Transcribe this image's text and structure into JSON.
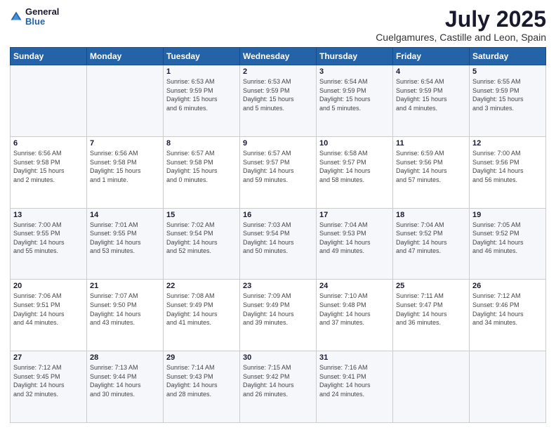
{
  "logo": {
    "text_general": "General",
    "text_blue": "Blue"
  },
  "header": {
    "month": "July 2025",
    "location": "Cuelgamures, Castille and Leon, Spain"
  },
  "weekdays": [
    "Sunday",
    "Monday",
    "Tuesday",
    "Wednesday",
    "Thursday",
    "Friday",
    "Saturday"
  ],
  "weeks": [
    [
      {
        "day": "",
        "info": ""
      },
      {
        "day": "",
        "info": ""
      },
      {
        "day": "1",
        "info": "Sunrise: 6:53 AM\nSunset: 9:59 PM\nDaylight: 15 hours\nand 6 minutes."
      },
      {
        "day": "2",
        "info": "Sunrise: 6:53 AM\nSunset: 9:59 PM\nDaylight: 15 hours\nand 5 minutes."
      },
      {
        "day": "3",
        "info": "Sunrise: 6:54 AM\nSunset: 9:59 PM\nDaylight: 15 hours\nand 5 minutes."
      },
      {
        "day": "4",
        "info": "Sunrise: 6:54 AM\nSunset: 9:59 PM\nDaylight: 15 hours\nand 4 minutes."
      },
      {
        "day": "5",
        "info": "Sunrise: 6:55 AM\nSunset: 9:59 PM\nDaylight: 15 hours\nand 3 minutes."
      }
    ],
    [
      {
        "day": "6",
        "info": "Sunrise: 6:56 AM\nSunset: 9:58 PM\nDaylight: 15 hours\nand 2 minutes."
      },
      {
        "day": "7",
        "info": "Sunrise: 6:56 AM\nSunset: 9:58 PM\nDaylight: 15 hours\nand 1 minute."
      },
      {
        "day": "8",
        "info": "Sunrise: 6:57 AM\nSunset: 9:58 PM\nDaylight: 15 hours\nand 0 minutes."
      },
      {
        "day": "9",
        "info": "Sunrise: 6:57 AM\nSunset: 9:57 PM\nDaylight: 14 hours\nand 59 minutes."
      },
      {
        "day": "10",
        "info": "Sunrise: 6:58 AM\nSunset: 9:57 PM\nDaylight: 14 hours\nand 58 minutes."
      },
      {
        "day": "11",
        "info": "Sunrise: 6:59 AM\nSunset: 9:56 PM\nDaylight: 14 hours\nand 57 minutes."
      },
      {
        "day": "12",
        "info": "Sunrise: 7:00 AM\nSunset: 9:56 PM\nDaylight: 14 hours\nand 56 minutes."
      }
    ],
    [
      {
        "day": "13",
        "info": "Sunrise: 7:00 AM\nSunset: 9:55 PM\nDaylight: 14 hours\nand 55 minutes."
      },
      {
        "day": "14",
        "info": "Sunrise: 7:01 AM\nSunset: 9:55 PM\nDaylight: 14 hours\nand 53 minutes."
      },
      {
        "day": "15",
        "info": "Sunrise: 7:02 AM\nSunset: 9:54 PM\nDaylight: 14 hours\nand 52 minutes."
      },
      {
        "day": "16",
        "info": "Sunrise: 7:03 AM\nSunset: 9:54 PM\nDaylight: 14 hours\nand 50 minutes."
      },
      {
        "day": "17",
        "info": "Sunrise: 7:04 AM\nSunset: 9:53 PM\nDaylight: 14 hours\nand 49 minutes."
      },
      {
        "day": "18",
        "info": "Sunrise: 7:04 AM\nSunset: 9:52 PM\nDaylight: 14 hours\nand 47 minutes."
      },
      {
        "day": "19",
        "info": "Sunrise: 7:05 AM\nSunset: 9:52 PM\nDaylight: 14 hours\nand 46 minutes."
      }
    ],
    [
      {
        "day": "20",
        "info": "Sunrise: 7:06 AM\nSunset: 9:51 PM\nDaylight: 14 hours\nand 44 minutes."
      },
      {
        "day": "21",
        "info": "Sunrise: 7:07 AM\nSunset: 9:50 PM\nDaylight: 14 hours\nand 43 minutes."
      },
      {
        "day": "22",
        "info": "Sunrise: 7:08 AM\nSunset: 9:49 PM\nDaylight: 14 hours\nand 41 minutes."
      },
      {
        "day": "23",
        "info": "Sunrise: 7:09 AM\nSunset: 9:49 PM\nDaylight: 14 hours\nand 39 minutes."
      },
      {
        "day": "24",
        "info": "Sunrise: 7:10 AM\nSunset: 9:48 PM\nDaylight: 14 hours\nand 37 minutes."
      },
      {
        "day": "25",
        "info": "Sunrise: 7:11 AM\nSunset: 9:47 PM\nDaylight: 14 hours\nand 36 minutes."
      },
      {
        "day": "26",
        "info": "Sunrise: 7:12 AM\nSunset: 9:46 PM\nDaylight: 14 hours\nand 34 minutes."
      }
    ],
    [
      {
        "day": "27",
        "info": "Sunrise: 7:12 AM\nSunset: 9:45 PM\nDaylight: 14 hours\nand 32 minutes."
      },
      {
        "day": "28",
        "info": "Sunrise: 7:13 AM\nSunset: 9:44 PM\nDaylight: 14 hours\nand 30 minutes."
      },
      {
        "day": "29",
        "info": "Sunrise: 7:14 AM\nSunset: 9:43 PM\nDaylight: 14 hours\nand 28 minutes."
      },
      {
        "day": "30",
        "info": "Sunrise: 7:15 AM\nSunset: 9:42 PM\nDaylight: 14 hours\nand 26 minutes."
      },
      {
        "day": "31",
        "info": "Sunrise: 7:16 AM\nSunset: 9:41 PM\nDaylight: 14 hours\nand 24 minutes."
      },
      {
        "day": "",
        "info": ""
      },
      {
        "day": "",
        "info": ""
      }
    ]
  ]
}
